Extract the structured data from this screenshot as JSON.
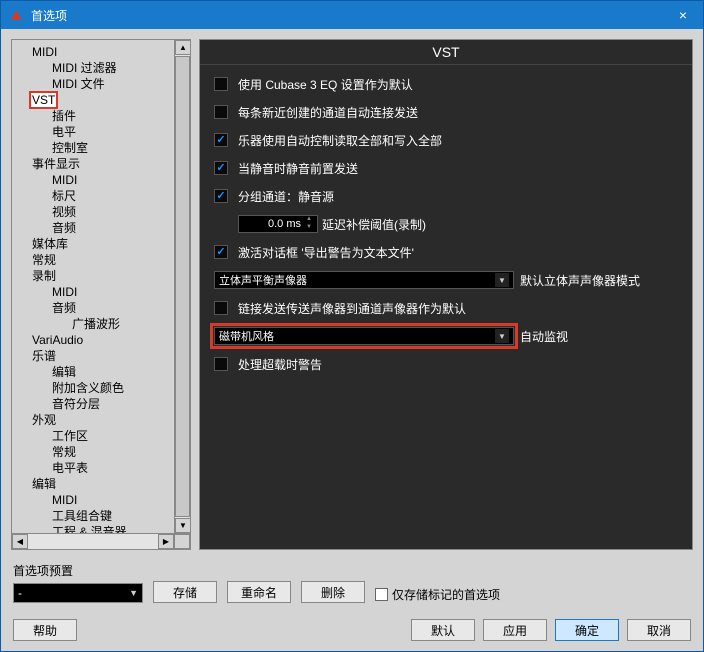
{
  "window": {
    "title": "首选项"
  },
  "tree": [
    {
      "label": "MIDI",
      "children": [
        "MIDI 过滤器",
        "MIDI 文件"
      ]
    },
    {
      "label": "VST",
      "children": [
        "插件",
        "电平",
        "控制室"
      ]
    },
    {
      "label": "事件显示",
      "children": [
        "MIDI",
        "标尺",
        "视频",
        "音频"
      ]
    },
    {
      "label": "媒体库"
    },
    {
      "label": "常规"
    },
    {
      "label": "录制",
      "children": [
        "MIDI",
        "音频",
        "广播波形"
      ]
    },
    {
      "label": "VariAudio"
    },
    {
      "label": "乐谱",
      "children": [
        "编辑",
        "附加含义颜色",
        "音符分层"
      ]
    },
    {
      "label": "外观",
      "children": [
        "工作区",
        "常规",
        "电平表"
      ]
    },
    {
      "label": "编辑",
      "children": [
        "MIDI",
        "工具组合键",
        "工程 & 混音器"
      ]
    }
  ],
  "panel": {
    "title": "VST",
    "options": [
      "使用 Cubase 3 EQ 设置作为默认",
      "每条新近创建的通道自动连接发送",
      "乐器使用自动控制读取全部和写入全部",
      "当静音时静音前置发送",
      "分组通道：静音源",
      "激活对话框 '导出警告为文本文件'",
      "链接发送传送声像器到通道声像器作为默认",
      "处理超载时警告"
    ],
    "latency_value": "0.0 ms",
    "latency_label": "延迟补偿阈值(录制)",
    "pan_mode_value": "立体声平衡声像器",
    "pan_mode_label": "默认立体声声像器模式",
    "auto_monitor_value": "磁带机风格",
    "auto_monitor_label": "自动监视"
  },
  "footer": {
    "preset_label": "首选项预置",
    "preset_value": "-",
    "store": "存储",
    "rename": "重命名",
    "delete": "删除",
    "store_marked": "仅存储标记的首选项",
    "help": "帮助",
    "default": "默认",
    "apply": "应用",
    "ok": "确定",
    "cancel": "取消"
  }
}
